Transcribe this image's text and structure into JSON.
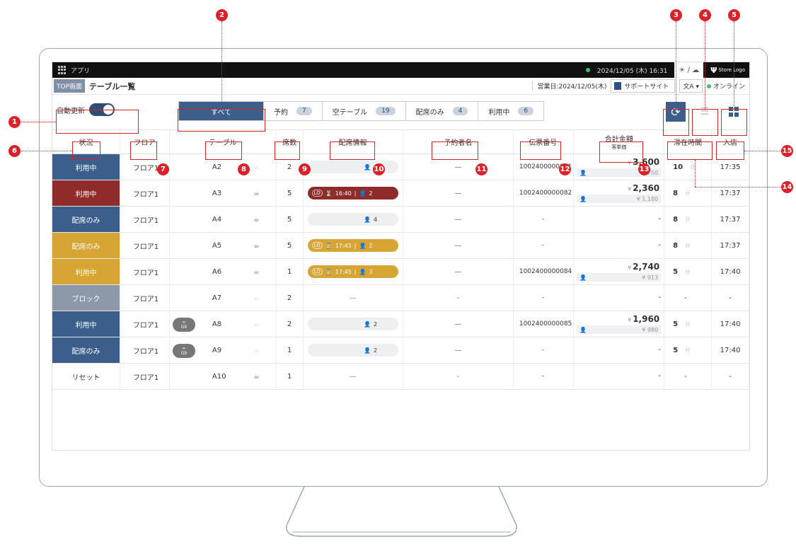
{
  "topbar": {
    "app_label": "アプリ",
    "datetime": "2024/12/05 (木) 16:31",
    "logo_text": "Store Logo"
  },
  "titlerow": {
    "top_tag": "TOP画面",
    "page_title": "テーブル一覧",
    "business_date": "営業日:2024/12/05(木)",
    "support_label": "サポートサイト",
    "lang_label": "文A",
    "online_label": "オンライン"
  },
  "controls": {
    "auto_update_label": "自動更新",
    "filters": [
      {
        "label": "すべて",
        "count": ""
      },
      {
        "label": "予約",
        "count": "7"
      },
      {
        "label": "空テーブル",
        "count": "19"
      },
      {
        "label": "配席のみ",
        "count": "4"
      },
      {
        "label": "利用中",
        "count": "6"
      }
    ]
  },
  "table": {
    "headers": {
      "status": "状況",
      "floor": "フロア",
      "table": "テーブル",
      "seats": "席数",
      "seating_info": "配席情報",
      "reserver": "予約者名",
      "slip_no": "伝票番号",
      "total": "合計金額",
      "total_sub": "客単価",
      "stay": "滞在時間",
      "entry": "入店"
    },
    "minute_unit": "分",
    "rows": [
      {
        "status": "利用中",
        "color": "#3b5f8a",
        "floor": "フロア1",
        "table": "A2",
        "seats": "2",
        "pill": "grey",
        "lo": "",
        "lo_time": "",
        "people": "4",
        "reserver": "—",
        "slip": "1002400000081",
        "total": "3,600",
        "per": "¥ 750",
        "stay": "10",
        "entry": "17:35",
        "g9": false
      },
      {
        "status": "利用中",
        "color": "#8e2b2b",
        "floor": "フロア1",
        "table": "A3",
        "seats": "5",
        "pill": "red",
        "lo": "LO",
        "lo_time": "16:40",
        "people": "2",
        "reserver": "—",
        "slip": "1002400000082",
        "total": "2,360",
        "per": "¥ 1,180",
        "stay": "8",
        "entry": "17:37",
        "g9": false
      },
      {
        "status": "配席のみ",
        "color": "#3b5f8a",
        "floor": "フロア1",
        "table": "A4",
        "seats": "5",
        "pill": "grey",
        "lo": "",
        "lo_time": "",
        "people": "4",
        "reserver": "—",
        "slip": "-",
        "total": "",
        "per": "",
        "stay": "8",
        "entry": "17:37",
        "g9": false
      },
      {
        "status": "配席のみ",
        "color": "#d6a533",
        "floor": "フロア1",
        "table": "A5",
        "seats": "5",
        "pill": "yellow",
        "lo": "LO",
        "lo_time": "17:45",
        "people": "2",
        "reserver": "—",
        "slip": "-",
        "total": "",
        "per": "",
        "stay": "8",
        "entry": "17:37",
        "g9": false
      },
      {
        "status": "利用中",
        "color": "#d6a533",
        "floor": "フロア1",
        "table": "A6",
        "seats": "1",
        "pill": "yellow",
        "lo": "LO",
        "lo_time": "17:45",
        "people": "3",
        "reserver": "—",
        "slip": "1002400000084",
        "total": "2,740",
        "per": "¥ 913",
        "stay": "5",
        "entry": "17:40",
        "g9": false
      },
      {
        "status": "ブロック",
        "color": "#8d99a8",
        "floor": "フロア1",
        "table": "A7",
        "seats": "2",
        "pill": "none",
        "lo": "",
        "lo_time": "",
        "people": "",
        "reserver": "-",
        "slip": "-",
        "total": "",
        "per": "",
        "stay": "-",
        "entry": "-",
        "g9": false
      },
      {
        "status": "利用中",
        "color": "#3b5f8a",
        "floor": "フロア1",
        "table": "A8",
        "seats": "2",
        "pill": "grey",
        "lo": "",
        "lo_time": "",
        "people": "2",
        "reserver": "—",
        "slip": "1002400000085",
        "total": "1,960",
        "per": "¥ 980",
        "stay": "5",
        "entry": "17:40",
        "g9": true
      },
      {
        "status": "配席のみ",
        "color": "#3b5f8a",
        "floor": "フロア1",
        "table": "A9",
        "seats": "1",
        "pill": "grey",
        "lo": "",
        "lo_time": "",
        "people": "2",
        "reserver": "—",
        "slip": "-",
        "total": "",
        "per": "",
        "stay": "5",
        "entry": "17:40",
        "g9": true
      },
      {
        "status": "リセット",
        "color": "#ffffff",
        "floor": "フロア1",
        "table": "A10",
        "seats": "1",
        "pill": "none",
        "lo": "",
        "lo_time": "",
        "people": "",
        "reserver": "-",
        "slip": "-",
        "total": "",
        "per": "",
        "stay": "-",
        "entry": "-",
        "g9": false
      }
    ]
  },
  "g9_label": "G9",
  "callouts": [
    "1",
    "2",
    "3",
    "4",
    "5",
    "6",
    "7",
    "8",
    "9",
    "10",
    "11",
    "12",
    "13",
    "14",
    "15"
  ]
}
